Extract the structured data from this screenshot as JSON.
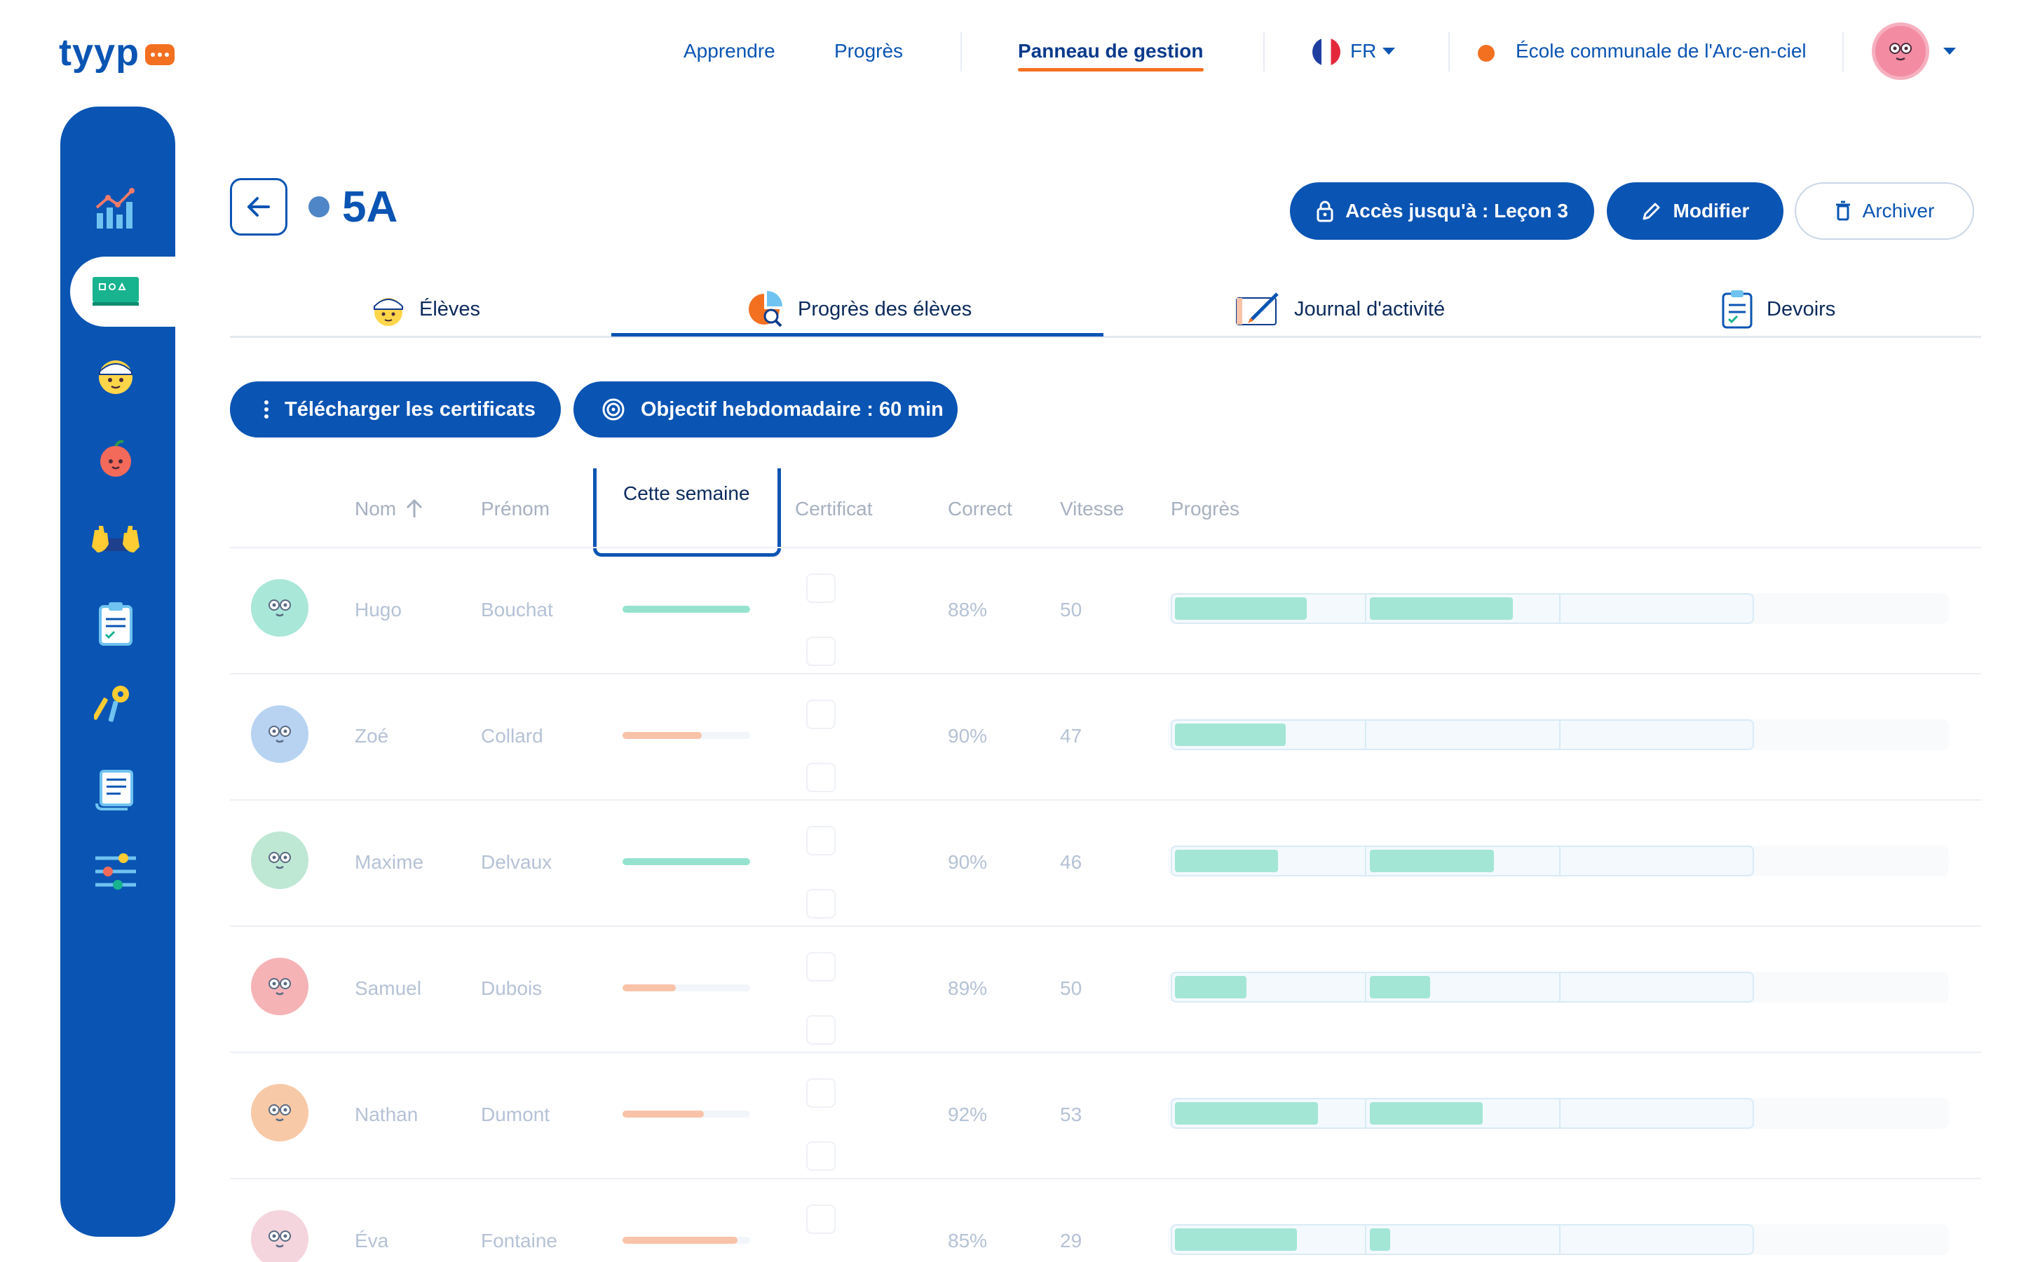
{
  "app": {
    "logo": "tyyp"
  },
  "nav": {
    "learn": "Apprendre",
    "progress": "Progrès",
    "dashboard": "Panneau de gestion",
    "language": "FR",
    "school": "École communale de l'Arc-en-ciel"
  },
  "sidebar": {
    "items": [
      {
        "icon": "chart-icon"
      },
      {
        "icon": "classroom-icon",
        "active": true
      },
      {
        "icon": "student-icon"
      },
      {
        "icon": "apple-icon"
      },
      {
        "icon": "hands-keyboard-icon"
      },
      {
        "icon": "clipboard-icon"
      },
      {
        "icon": "keys-icon"
      },
      {
        "icon": "scroll-icon"
      },
      {
        "icon": "settings-sliders-icon"
      }
    ]
  },
  "header": {
    "class_name": "5A",
    "access_button": "Accès jusqu'à : Leçon 3",
    "edit_button": "Modifier",
    "archive_button": "Archiver"
  },
  "tabs": [
    {
      "label": "Élèves",
      "icon": "student-face-icon"
    },
    {
      "label": "Progrès des élèves",
      "icon": "pie-chart-magnifier-icon",
      "active": true
    },
    {
      "label": "Journal d'activité",
      "icon": "notebook-pencil-icon"
    },
    {
      "label": "Devoirs",
      "icon": "clipboard-list-icon"
    }
  ],
  "actions": {
    "download_certificates": "Télécharger les certificats",
    "weekly_goal": "Objectif hebdomadaire : 60 min"
  },
  "table": {
    "columns": {
      "last_name": "Nom",
      "first_name": "Prénom",
      "this_week": "Cette semaine",
      "certificate": "Certificat",
      "correct": "Correct",
      "speed": "Vitesse",
      "progress": "Progrès"
    },
    "rows": [
      {
        "first": "Hugo",
        "last": "Bouchat",
        "correct": "88%",
        "speed": "50",
        "week": 1.0,
        "week_color": "#95e3cf",
        "segments": [
          0.7,
          0.76,
          0
        ],
        "avatar_color": "#a9e7d8"
      },
      {
        "first": "Zoé",
        "last": "Collard",
        "correct": "90%",
        "speed": "47",
        "week": 0.62,
        "week_color": "#f8c3a8",
        "segments": [
          0.59,
          0,
          0
        ],
        "avatar_color": "#b8d3f1"
      },
      {
        "first": "Maxime",
        "last": "Delvaux",
        "correct": "90%",
        "speed": "46",
        "week": 1.0,
        "week_color": "#95e3cf",
        "segments": [
          0.55,
          0.66,
          0
        ],
        "avatar_color": "#bfe8d4"
      },
      {
        "first": "Samuel",
        "last": "Dubois",
        "correct": "89%",
        "speed": "50",
        "week": 0.42,
        "week_color": "#f8c3a8",
        "segments": [
          0.38,
          0.32,
          0
        ],
        "avatar_color": "#f5b3b6"
      },
      {
        "first": "Nathan",
        "last": "Dumont",
        "correct": "92%",
        "speed": "53",
        "week": 0.64,
        "week_color": "#f8c3a8",
        "segments": [
          0.76,
          0.6,
          0
        ],
        "avatar_color": "#f8c9a7"
      },
      {
        "first": "Éva",
        "last": "Fontaine",
        "correct": "85%",
        "speed": "29",
        "week": 0.9,
        "week_color": "#f8c3a8",
        "segments": [
          0.65,
          0.11,
          0
        ],
        "avatar_color": "#f4d5de"
      }
    ]
  },
  "colors": {
    "brand": "#0a54b3",
    "accent": "#f37021",
    "progress_fill": "#a3e6d5"
  }
}
